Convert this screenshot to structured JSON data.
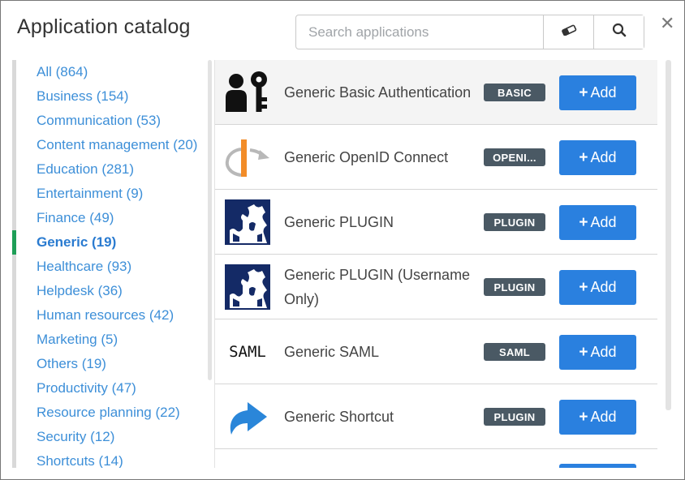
{
  "title": "Application catalog",
  "search": {
    "placeholder": "Search applications"
  },
  "categories": [
    {
      "label": "All (864)"
    },
    {
      "label": "Business (154)"
    },
    {
      "label": "Communication (53)"
    },
    {
      "label": "Content management (20)"
    },
    {
      "label": "Education (281)"
    },
    {
      "label": "Entertainment (9)"
    },
    {
      "label": "Finance (49)"
    },
    {
      "label": "Generic (19)",
      "active": true
    },
    {
      "label": "Healthcare (93)"
    },
    {
      "label": "Helpdesk (36)"
    },
    {
      "label": "Human resources (42)"
    },
    {
      "label": "Marketing (5)"
    },
    {
      "label": "Others (19)"
    },
    {
      "label": "Productivity (47)"
    },
    {
      "label": "Resource planning (22)"
    },
    {
      "label": "Security (12)"
    },
    {
      "label": "Shortcuts (14)"
    }
  ],
  "apps": [
    {
      "name": "Generic Basic Authentication",
      "badge": "BASIC",
      "icon": "person-key-icon",
      "add_label": "Add"
    },
    {
      "name": "Generic OpenID Connect",
      "badge": "OPENI...",
      "icon": "openid-icon",
      "add_label": "Add"
    },
    {
      "name": "Generic PLUGIN",
      "badge": "PLUGIN",
      "icon": "plugin-puzzle-icon",
      "add_label": "Add"
    },
    {
      "name": "Generic PLUGIN (Username Only)",
      "badge": "PLUGIN",
      "icon": "plugin-puzzle-icon",
      "add_label": "Add"
    },
    {
      "name": "Generic SAML",
      "badge": "SAML",
      "icon": "saml-logo",
      "add_label": "Add",
      "logo_text": "SAML"
    },
    {
      "name": "Generic Shortcut",
      "badge": "PLUGIN",
      "icon": "shortcut-arrow-icon",
      "add_label": "Add"
    }
  ],
  "colors": {
    "accent": "#2a80df",
    "link": "#3d8fd8",
    "active_marker": "#1e9e57",
    "badge_bg": "#4a5964"
  }
}
